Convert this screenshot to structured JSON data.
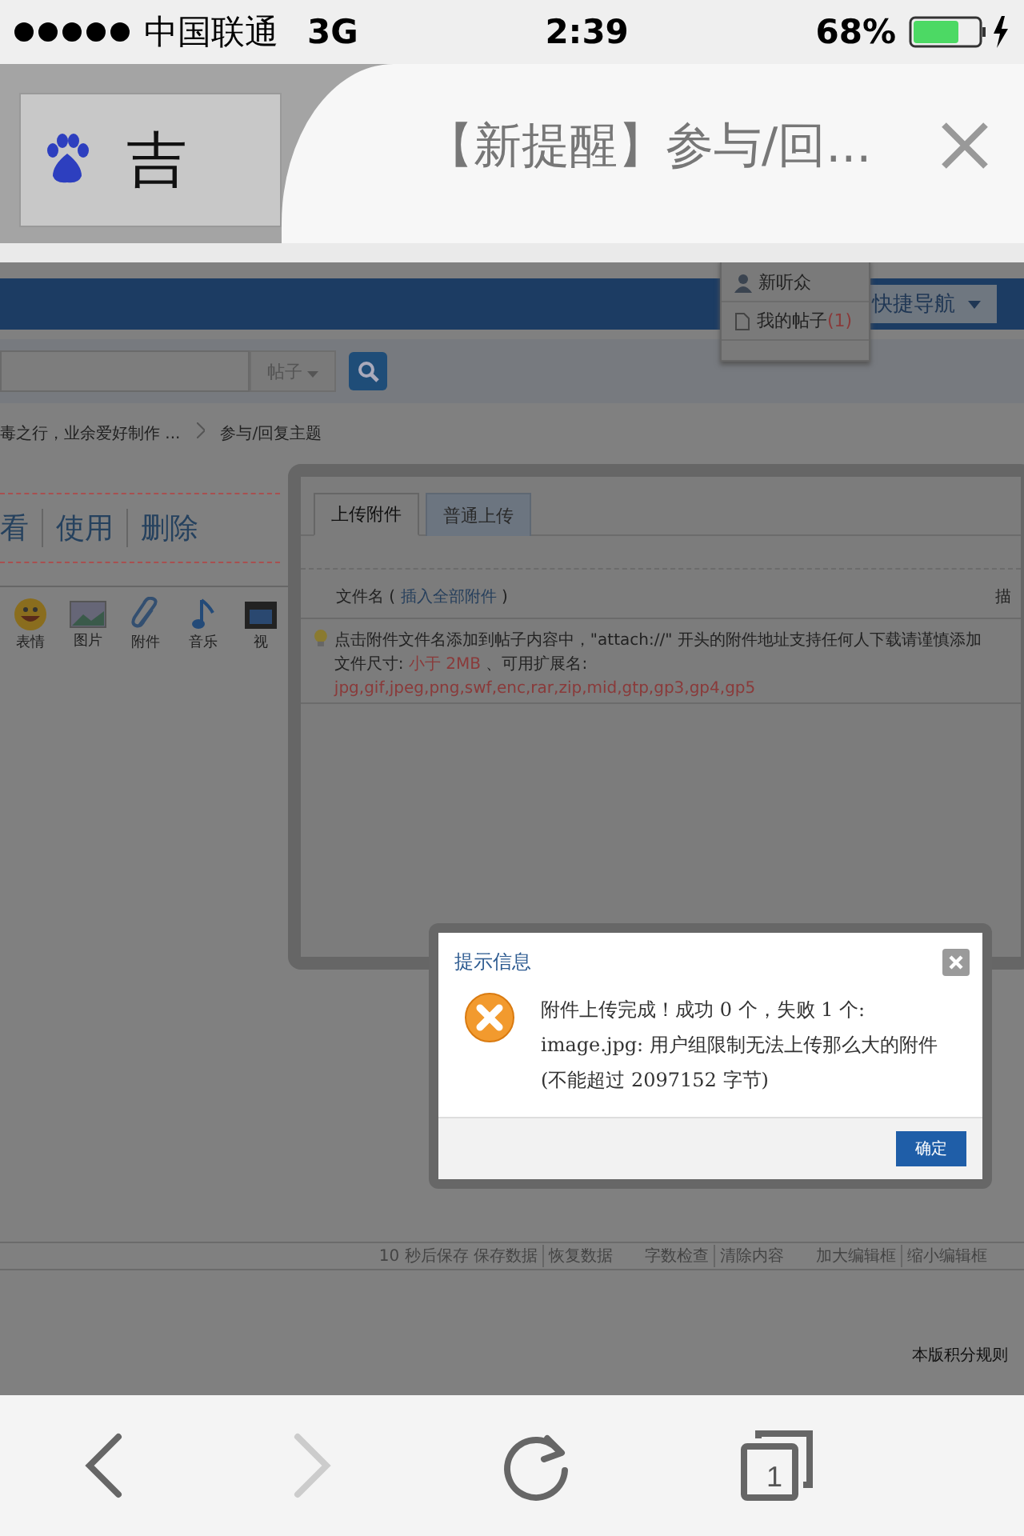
{
  "status_bar": {
    "carrier": "中国联通",
    "network": "3G",
    "time": "2:39",
    "battery": "68%"
  },
  "browser_tabs": [
    {
      "title": "吉",
      "selected": false
    },
    {
      "title": "【新提醒】参与/回...",
      "selected": true
    }
  ],
  "page": {
    "nav_menu": [
      {
        "label": "新听众",
        "kind": "user"
      },
      {
        "label": "我的帖子",
        "count": "(1)",
        "kind": "doc"
      }
    ],
    "quick_nav": "快捷导航",
    "search_type": "帖子",
    "breadcrumb": [
      "毒之行，业余爱好制作 ...",
      "参与/回复主题"
    ],
    "actions": [
      "看",
      "使用",
      "删除"
    ],
    "editor_tools": [
      {
        "label": "表情",
        "kind": "smiley"
      },
      {
        "label": "图片",
        "kind": "image"
      },
      {
        "label": "附件",
        "kind": "clip"
      },
      {
        "label": "音乐",
        "kind": "note"
      },
      {
        "label": "视",
        "kind": "film"
      }
    ],
    "editor_footer": [
      [
        "10 秒后保存 保存数据",
        "恢复数据"
      ],
      [
        "字数检查",
        "清除内容"
      ],
      [
        "加大编辑框",
        "缩小编辑框"
      ]
    ],
    "rules_link": "本版积分规则"
  },
  "upload_panel": {
    "tabs": [
      {
        "label": "上传附件",
        "selected": true
      },
      {
        "label": "普通上传",
        "selected": false
      }
    ],
    "filename_label": "文件名 (",
    "insert_all": "插入全部附件",
    "filename_close": ")",
    "column_2": "描",
    "tip": "点击附件文件名添加到帖子内容中，\"attach://\" 开头的附件地址支持任何人下载请谨慎添加",
    "size_label": "文件尺寸:",
    "size_value": "小于 2MB",
    "ext_label": "、可用扩展名:",
    "ext_value": "jpg,gif,jpeg,png,swf,enc,rar,zip,mid,gtp,gp3,gp4,gp5"
  },
  "dialog": {
    "title": "提示信息",
    "message": "附件上传完成！成功 0 个，失败 1 个: image.jpg: 用户组限制无法上传那么大的附件(不能超过 2097152 字节)",
    "button": "确定"
  },
  "toolbar": {
    "back_disabled": false,
    "forward_disabled": true,
    "tab_count": "1"
  }
}
